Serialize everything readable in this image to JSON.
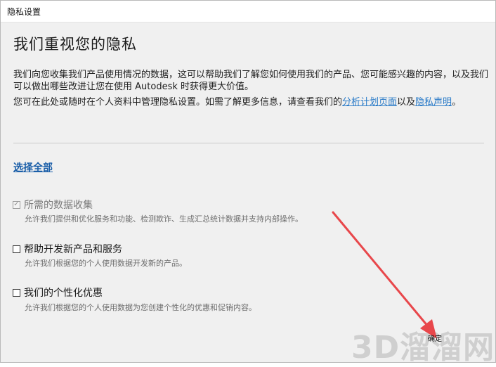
{
  "window": {
    "title": "隐私设置"
  },
  "heading": "我们重视您的隐私",
  "intro": "我们向您收集我们产品使用情况的数据，这可以帮助我们了解您如何使用我们的产品、您可能感兴趣的内容，以及我们可以做出哪些改进让您在使用 Autodesk 时获得更大价值。",
  "manage": {
    "prefix": "您可在此处或随时在个人资料中管理隐私设置。如需了解更多信息，请查看我们的",
    "link1": "分析计划页面",
    "middle": "以及",
    "link2": "隐私声明",
    "suffix": "。"
  },
  "select_all": "选择全部",
  "options": [
    {
      "label": "所需的数据收集",
      "desc": "允许我们提供和优化服务和功能、检测欺诈、生成汇总统计数据并支持内部操作。",
      "checked": true,
      "disabled": true
    },
    {
      "label": "帮助开发新产品和服务",
      "desc": "允许我们根据您的个人使用数据开发新的产品。",
      "checked": false,
      "disabled": false
    },
    {
      "label": "我们的个性化优惠",
      "desc": "允许我们根据您的个人使用数据为您创建个性化的优惠和促销内容。",
      "checked": false,
      "disabled": false
    }
  ],
  "confirm_label": "确定",
  "watermark": "3D溜溜网",
  "colors": {
    "link": "#2a7bc8",
    "arrow": "#e8474b",
    "select_all": "#1a5ea8"
  }
}
